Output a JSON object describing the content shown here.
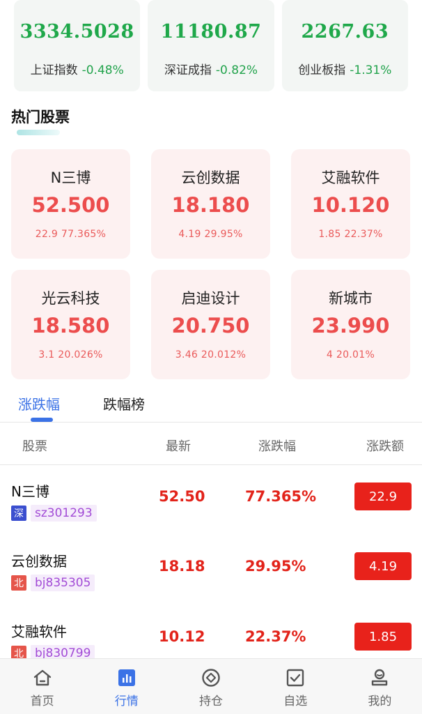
{
  "indices": [
    {
      "value": "3334.5028",
      "name": "上证指数",
      "change": "-0.48%"
    },
    {
      "value": "11180.87",
      "name": "深证成指",
      "change": "-0.82%"
    },
    {
      "value": "2267.63",
      "name": "创业板指",
      "change": "-1.31%"
    }
  ],
  "hot": {
    "title": "热门股票",
    "cards": [
      {
        "name": "N三博",
        "price": "52.500",
        "sub": "22.9 77.365%"
      },
      {
        "name": "云创数据",
        "price": "18.180",
        "sub": "4.19 29.95%"
      },
      {
        "name": "艾融软件",
        "price": "10.120",
        "sub": "1.85 22.37%"
      },
      {
        "name": "光云科技",
        "price": "18.580",
        "sub": "3.1 20.026%"
      },
      {
        "name": "启迪设计",
        "price": "20.750",
        "sub": "3.46 20.012%"
      },
      {
        "name": "新城市",
        "price": "23.990",
        "sub": "4 20.01%"
      }
    ]
  },
  "tabs": {
    "active": "涨跌幅",
    "inactive": "跌幅榜"
  },
  "table": {
    "headers": {
      "stock": "股票",
      "latest": "最新",
      "pct": "涨跌幅",
      "amt": "涨跌额"
    },
    "rows": [
      {
        "name": "N三博",
        "market": "深",
        "market_color": "#3b4fcf",
        "code": "sz301293",
        "latest": "52.50",
        "pct": "77.365%",
        "amt": "22.9"
      },
      {
        "name": "云创数据",
        "market": "北",
        "market_color": "#e5554a",
        "code": "bj835305",
        "latest": "18.18",
        "pct": "29.95%",
        "amt": "4.19"
      },
      {
        "name": "艾融软件",
        "market": "北",
        "market_color": "#e5554a",
        "code": "bj830799",
        "latest": "10.12",
        "pct": "22.37%",
        "amt": "1.85"
      }
    ]
  },
  "nav": {
    "items": [
      {
        "label": "首页",
        "icon": "home-icon"
      },
      {
        "label": "行情",
        "icon": "chart-icon"
      },
      {
        "label": "持仓",
        "icon": "coin-icon"
      },
      {
        "label": "自选",
        "icon": "checkbox-icon"
      },
      {
        "label": "我的",
        "icon": "profile-icon"
      }
    ],
    "active_index": 1
  },
  "colors": {
    "up_red": "#e2231a",
    "down_green": "#22a34c",
    "accent_blue": "#3b72e6"
  }
}
